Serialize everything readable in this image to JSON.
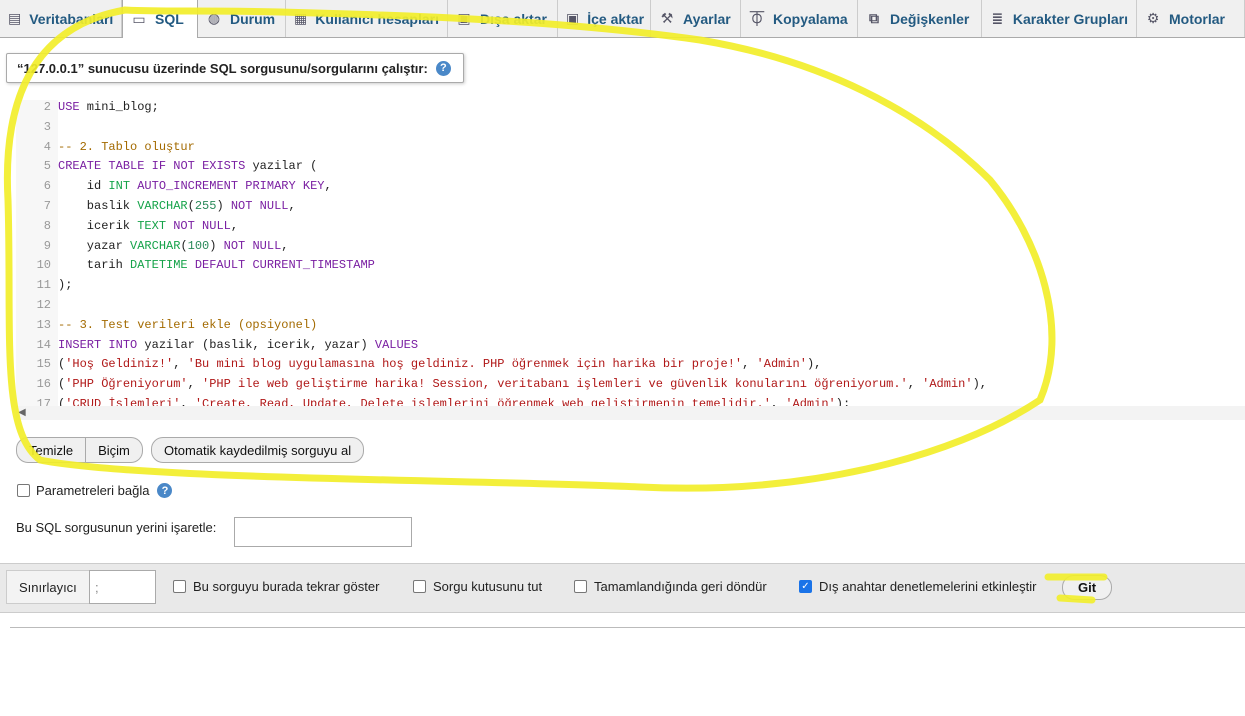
{
  "tabs": [
    {
      "label": "Veritabanları",
      "icon": "database-icon"
    },
    {
      "label": "SQL",
      "icon": "sql-icon",
      "active": true
    },
    {
      "label": "Durum",
      "icon": "status-icon"
    },
    {
      "label": "Kullanıcı hesapları",
      "icon": "users-icon"
    },
    {
      "label": "Dışa aktar",
      "icon": "export-icon"
    },
    {
      "label": "İçe aktar",
      "icon": "import-icon"
    },
    {
      "label": "Ayarlar",
      "icon": "wrench-icon"
    },
    {
      "label": "Kopyalama",
      "icon": "replication-icon"
    },
    {
      "label": "Değişkenler",
      "icon": "variables-icon"
    },
    {
      "label": "Karakter Grupları",
      "icon": "charset-icon"
    },
    {
      "label": "Motorlar",
      "icon": "engines-icon"
    }
  ],
  "query_title": "“127.0.0.1” sunucusu üzerinde SQL sorgusunu/sorgularını çalıştır:",
  "editor": {
    "lines": [
      {
        "n": "2",
        "text": "USE mini_blog;"
      },
      {
        "n": "3",
        "text": ""
      },
      {
        "n": "4",
        "text": "-- 2. Tablo oluştur"
      },
      {
        "n": "5",
        "text": "CREATE TABLE IF NOT EXISTS yazilar ("
      },
      {
        "n": "6",
        "text": "    id INT AUTO_INCREMENT PRIMARY KEY,"
      },
      {
        "n": "7",
        "text": "    baslik VARCHAR(255) NOT NULL,"
      },
      {
        "n": "8",
        "text": "    icerik TEXT NOT NULL,"
      },
      {
        "n": "9",
        "text": "    yazar VARCHAR(100) NOT NULL,"
      },
      {
        "n": "10",
        "text": "    tarih DATETIME DEFAULT CURRENT_TIMESTAMP"
      },
      {
        "n": "11",
        "text": ");"
      },
      {
        "n": "12",
        "text": ""
      },
      {
        "n": "13",
        "text": "-- 3. Test verileri ekle (opsiyonel)"
      },
      {
        "n": "14",
        "text": "INSERT INTO yazilar (baslik, icerik, yazar) VALUES"
      },
      {
        "n": "15",
        "text": "('Hoş Geldiniz!', 'Bu mini blog uygulamasına hoş geldiniz. PHP öğrenmek için harika bir proje!', 'Admin'),"
      },
      {
        "n": "16",
        "text": "('PHP Öğreniyorum', 'PHP ile web geliştirme harika! Session, veritabanı işlemleri ve güvenlik konularını öğreniyorum.', 'Admin'),"
      },
      {
        "n": "17",
        "text": "('CRUD İşlemleri', 'Create, Read, Update, Delete işlemlerini öğrenmek web geliştirmenin temelidir.', 'Admin');"
      }
    ]
  },
  "buttons": {
    "clear": "Temizle",
    "format": "Biçim",
    "autosave": "Otomatik kaydedilmiş sorguyu al"
  },
  "bind_params": "Parametreleri bağla",
  "bookmark_label": "Bu SQL sorgusunun yerini işaretle:",
  "delimiter_label": "Sınırlayıcı",
  "delimiter_value": ";",
  "options": [
    {
      "label": "Bu sorguyu burada tekrar göster",
      "checked": false
    },
    {
      "label": "Sorgu kutusunu tut",
      "checked": false
    },
    {
      "label": "Tamamlandığında geri döndür",
      "checked": false
    },
    {
      "label": "Dış anahtar denetlemelerini etkinleştir",
      "checked": true
    }
  ],
  "go_button": "Git",
  "colors": {
    "highlight": "#f2ee2a",
    "tab_text": "#235a81",
    "check": "#1a73e8"
  }
}
